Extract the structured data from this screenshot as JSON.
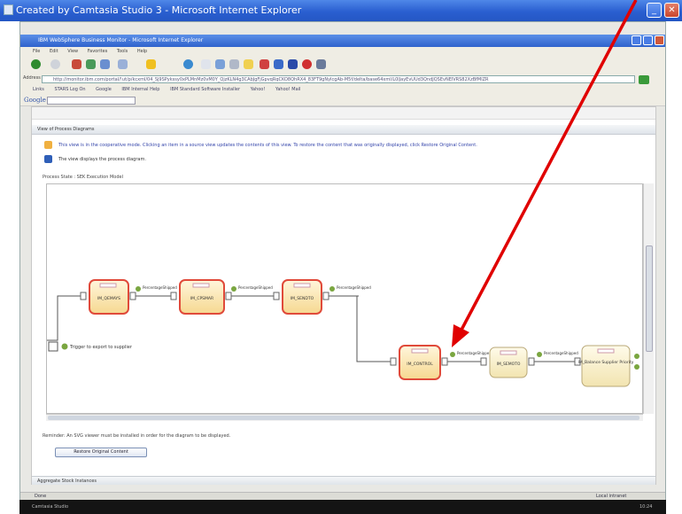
{
  "outer_window": {
    "title": "Created by Camtasia Studio 3 - Microsoft Internet Explorer"
  },
  "browser": {
    "title": "IBM WebSphere Business Monitor - Microsoft Internet Explorer",
    "menu": [
      "File",
      "Edit",
      "View",
      "Favorites",
      "Tools",
      "Help"
    ],
    "address_label": "Address",
    "address_url": "http://monitor.ibm.com/portal/!ut/p/kcxml/04_Sj9SPykssy0xPLMnMz0vM0Y_QjzKLN4g3CAbJgFjGpvqRqCKO8QhRX4_83FT9gNyIcgAb-M5f/delta/base64xml/L0lJayEvUUd3QndJQSEvNElVRS82XzBfMlZR",
    "links": [
      "Links",
      "STARS Log On",
      "Google",
      "IBM Internal Help",
      "IBM Standard Software Installer",
      "Yahoo!",
      "Yahoo! Mail"
    ],
    "google_label": "Google"
  },
  "content": {
    "section_title": "View of Process Diagrams",
    "info_line_1": "This view is in the cooperative mode. Clicking an item in a source view updates the contents of this view. To restore the content that was originally displayed, click Restore Original Content.",
    "info_line_2": "The view displays the process diagram.",
    "process_state": "Process State : SEK Execution Model",
    "reminder": "Reminder: An SVG viewer must be installed in order for the diagram to be displayed.",
    "restore_button": "Restore Original Content",
    "aggregate_title": "Aggregate Stock Instances"
  },
  "diagram": {
    "nodes": [
      {
        "label": "IM_QEMAYS"
      },
      {
        "label": "IM_CPSMAR"
      },
      {
        "label": "IM_SENDTO"
      },
      {
        "label": "IM_CONTROL"
      },
      {
        "label": "IM_SEMOTO"
      },
      {
        "label": "IM_Balance Supplier Priority"
      }
    ],
    "connector_labels": [
      "PercentageShipped",
      "PercentageShipped",
      "PercentageShipped",
      "PercentageShipped",
      "PercentageShipped"
    ],
    "start_label": "Trigger to export to supplier"
  },
  "status": {
    "left": "Done",
    "zone": "Local intranet"
  },
  "taskbar": {
    "app": "Camtasia Studio",
    "clock": "10:24"
  },
  "colors": {
    "node_fill_highlight": "#fbe3a8",
    "node_border_highlight": "#e04a3a",
    "node_fill_normal": "#fbf1c8",
    "arrow": "#e00000"
  }
}
